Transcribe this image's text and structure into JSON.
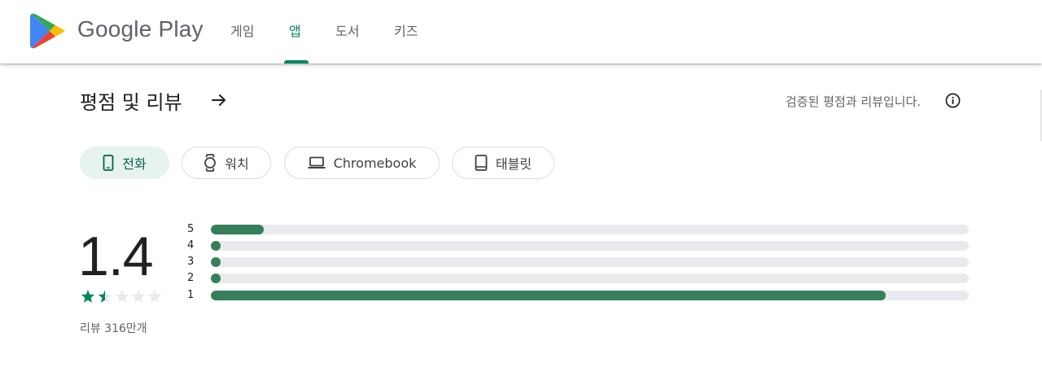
{
  "header": {
    "brand": "Google Play",
    "nav": [
      {
        "label": "게임",
        "active": false
      },
      {
        "label": "앱",
        "active": true
      },
      {
        "label": "도서",
        "active": false
      },
      {
        "label": "키즈",
        "active": false
      }
    ]
  },
  "ratings": {
    "title": "평점 및 리뷰",
    "verified_text": "검증된 평점과 리뷰입니다.",
    "devices": [
      {
        "label": "전화",
        "icon": "phone-icon",
        "selected": true
      },
      {
        "label": "워치",
        "icon": "watch-icon",
        "selected": false
      },
      {
        "label": "Chromebook",
        "icon": "laptop-icon",
        "selected": false
      },
      {
        "label": "태블릿",
        "icon": "tablet-icon",
        "selected": false
      }
    ],
    "score": "1.4",
    "stars_value": 1.4,
    "review_count": "리뷰 316만개",
    "histogram": [
      {
        "label": "5",
        "fraction": 0.07
      },
      {
        "label": "4",
        "fraction": 0.01
      },
      {
        "label": "3",
        "fraction": 0.01
      },
      {
        "label": "2",
        "fraction": 0.01
      },
      {
        "label": "1",
        "fraction": 0.89
      }
    ]
  },
  "colors": {
    "accent": "#01875f",
    "bar_fill": "#357f5b",
    "bar_track": "#e8eaed",
    "chip_selected_bg": "#e6f3ef"
  }
}
